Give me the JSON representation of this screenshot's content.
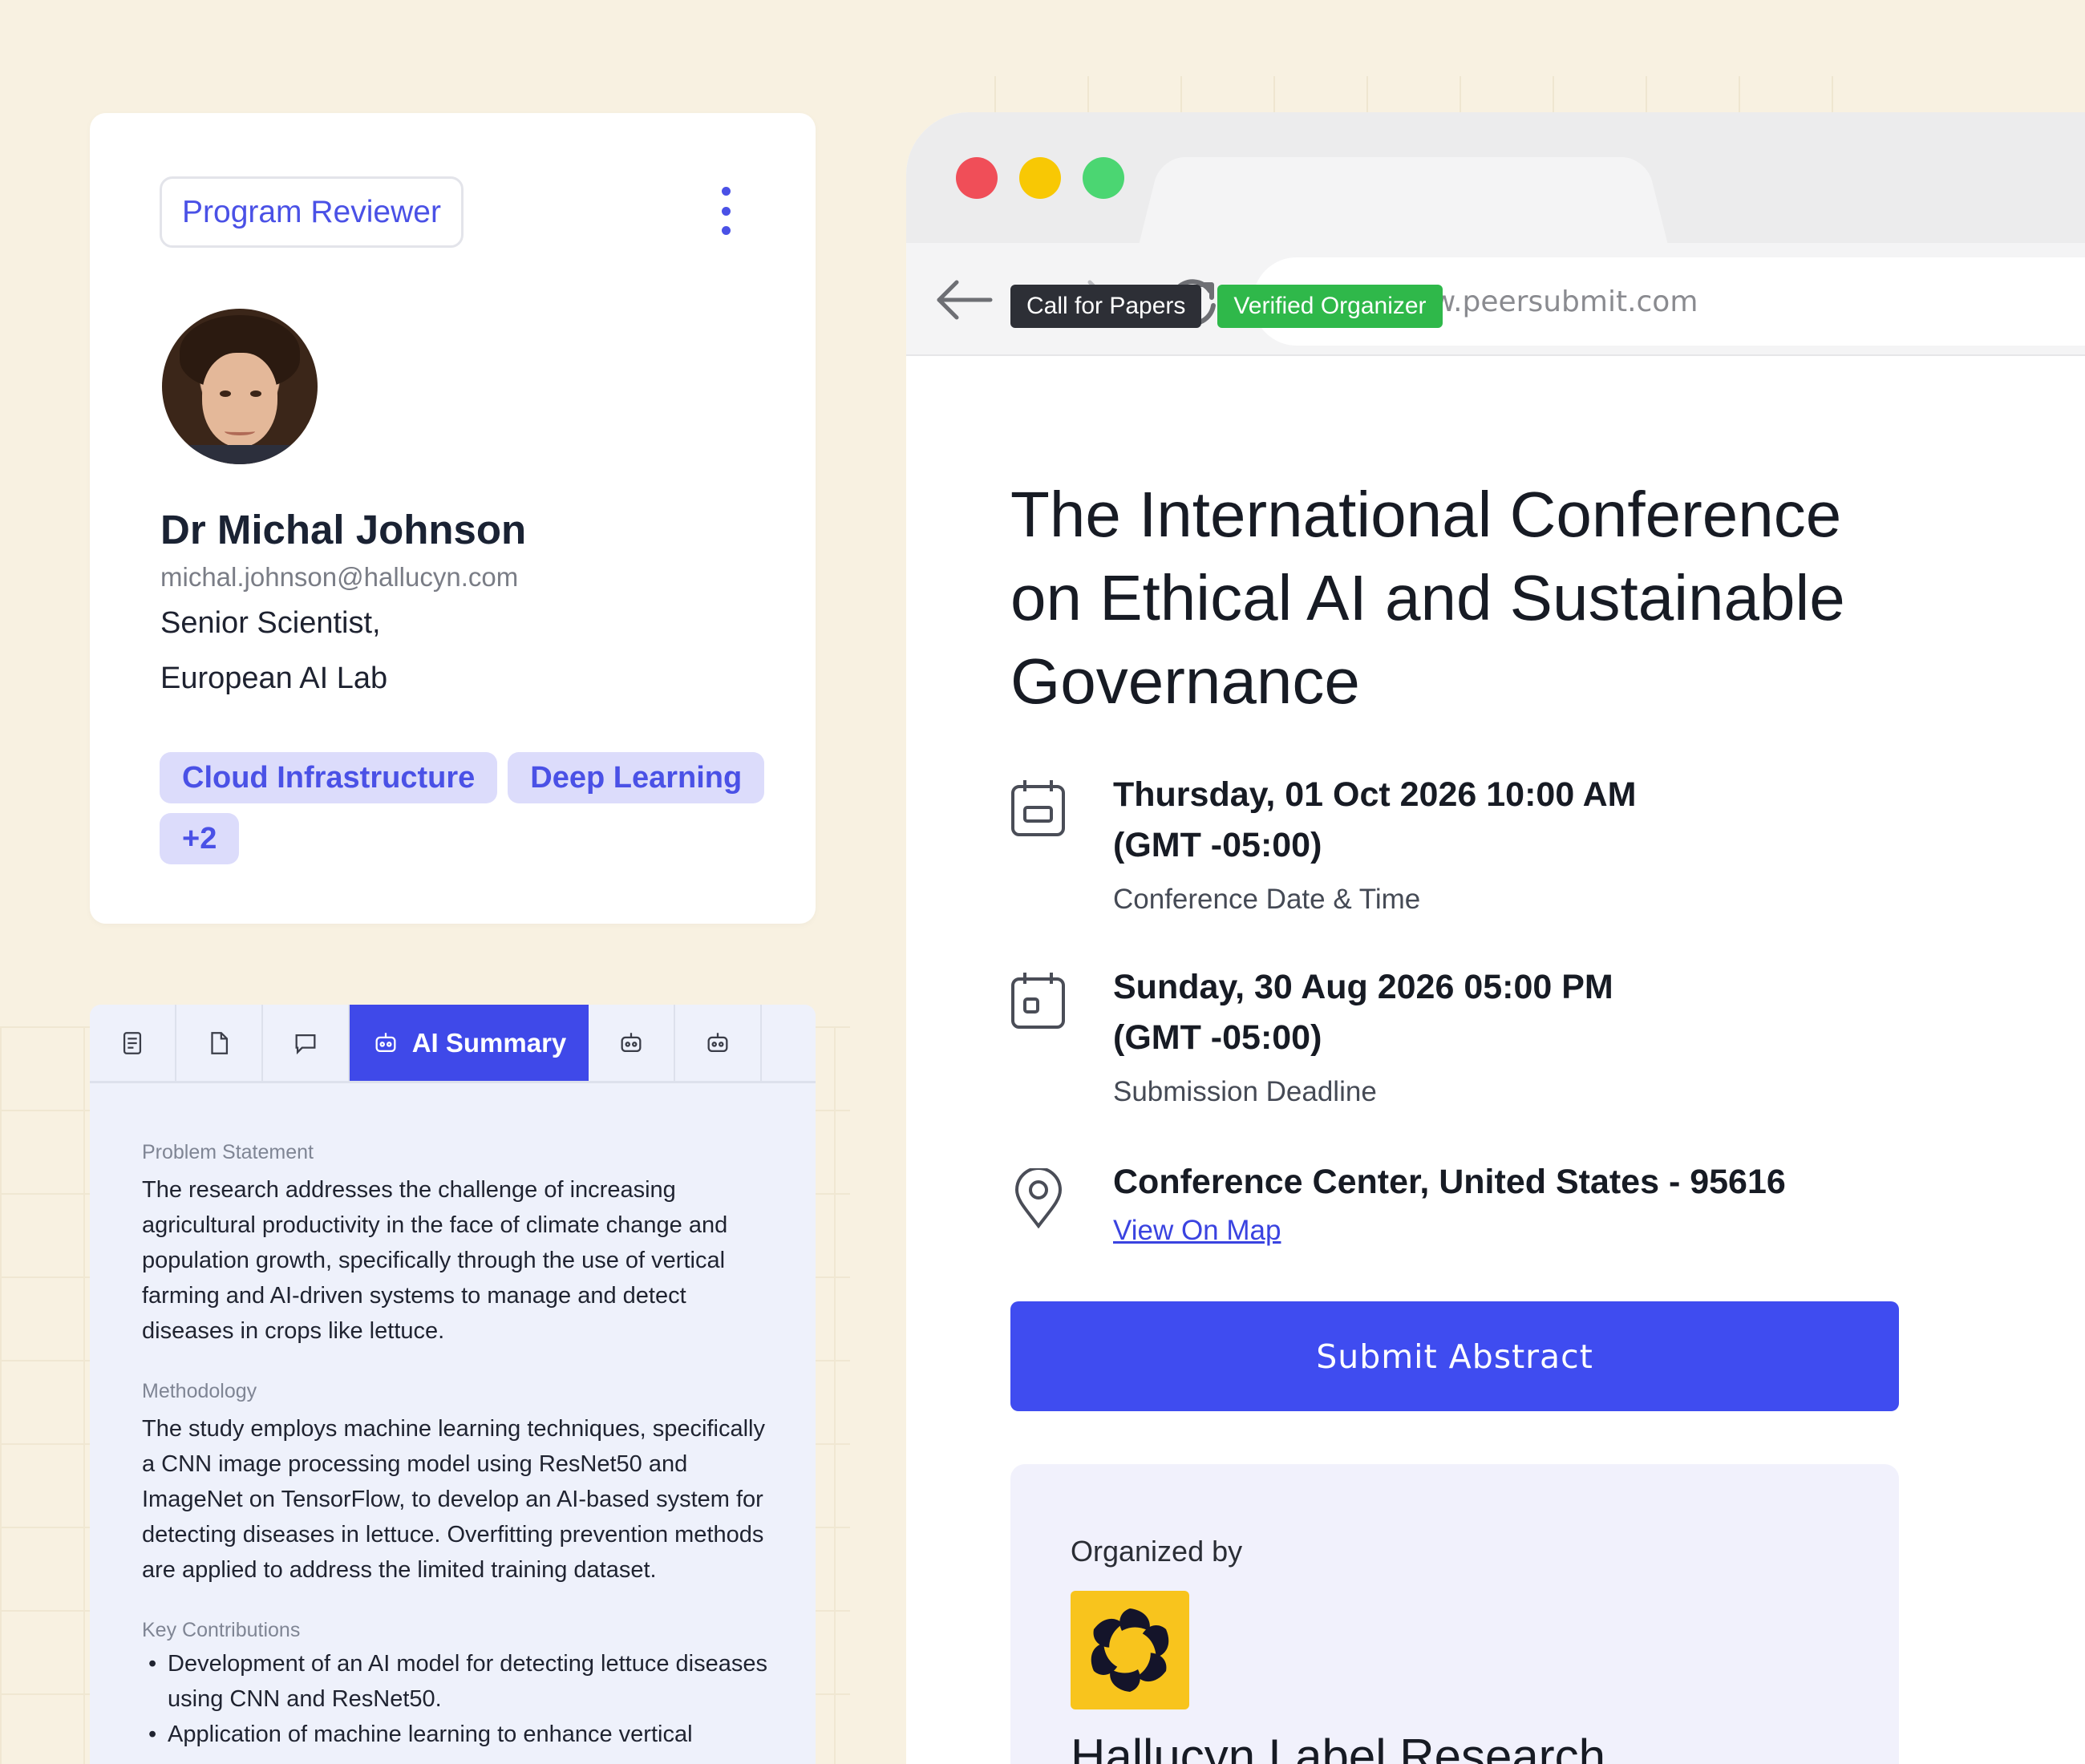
{
  "profile": {
    "role": "Program Reviewer",
    "name": "Dr Michal Johnson",
    "email": "michal.johnson@hallucyn.com",
    "title": "Senior Scientist,",
    "org": "European AI Lab",
    "tags": [
      "Cloud Infrastructure",
      "Deep Learning",
      "+2"
    ]
  },
  "summary": {
    "tabs": [
      {
        "icon": "document-list-icon"
      },
      {
        "icon": "file-icon"
      },
      {
        "icon": "chat-bubble-icon"
      },
      {
        "icon": "robot-icon",
        "label": "AI Summary",
        "active": true
      },
      {
        "icon": "robot-icon"
      },
      {
        "icon": "robot-icon"
      }
    ],
    "active_tab_label": "AI Summary",
    "problem_label": "Problem Statement",
    "problem_text": "The research addresses the challenge of increasing agricultural productivity in the face of climate change and population growth, specifically through the use of vertical farming and AI-driven systems to manage and detect diseases in crops like lettuce.",
    "method_label": "Methodology",
    "method_text": "The study employs machine learning techniques, specifically a CNN image processing model using ResNet50 and ImageNet on TensorFlow, to develop an AI-based system for detecting diseases in lettuce. Overfitting prevention methods are applied to address the limited training dataset.",
    "contrib_label": "Key Contributions",
    "contributions": [
      "Development of an AI model for detecting lettuce diseases using CNN and ResNet50.",
      "Application of machine learning to enhance vertical"
    ]
  },
  "browser": {
    "url": "https://www.peersubmit.com",
    "window_dots": {
      "red": "#f04e58",
      "yellow": "#f8c804",
      "green": "#4bd672"
    }
  },
  "event": {
    "badges": [
      "Call for Papers",
      "Verified Organizer"
    ],
    "title": "The International Conference on Ethical AI and Sustainable Governance",
    "date_main": "Thursday, 01 Oct 2026 10:00 AM",
    "date_tz": "(GMT -05:00)",
    "date_label": "Conference Date & Time",
    "deadline_main": "Sunday, 30 Aug 2026 05:00 PM",
    "deadline_tz": "(GMT -05:00)",
    "deadline_label": "Submission Deadline",
    "location": "Conference Center, United States - 95616",
    "map_link": "View On Map",
    "submit_label": "Submit Abstract",
    "organized_by": "Organized by",
    "organizer_name": "Hallucyn Label Research"
  },
  "colors": {
    "accent": "#3f4cf0",
    "tag_bg": "#dcdcfb",
    "verified": "#2fb84a",
    "background": "#f8f1e1"
  }
}
